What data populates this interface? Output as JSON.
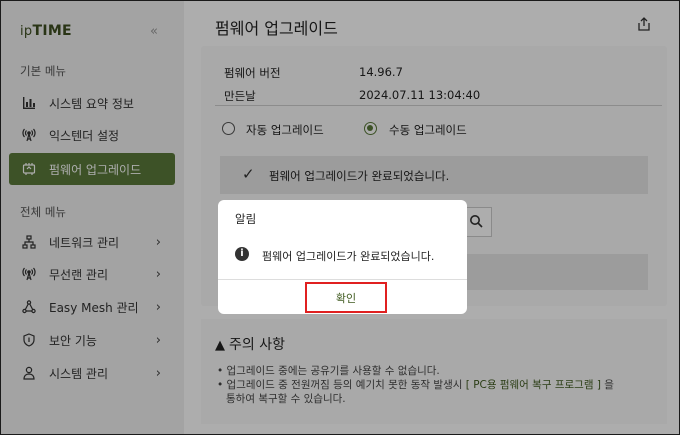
{
  "brand": {
    "prefix": "ip",
    "name": "TIME"
  },
  "sidebar": {
    "collapse_icon": "double-chevron-left-icon",
    "basic_section": "기본 메뉴",
    "basic_items": [
      {
        "label": "시스템 요약 정보",
        "icon": "bar-chart-icon"
      },
      {
        "label": "익스텐더 설정",
        "icon": "wireless-antenna-icon"
      },
      {
        "label": "펌웨어 업그레이드",
        "icon": "firmware-icon",
        "active": true
      }
    ],
    "all_section": "전체 메뉴",
    "all_items": [
      {
        "label": "네트워크 관리",
        "icon": "network-icon"
      },
      {
        "label": "무선랜 관리",
        "icon": "wireless-antenna-icon"
      },
      {
        "label": "Easy Mesh 관리",
        "icon": "mesh-icon"
      },
      {
        "label": "보안 기능",
        "icon": "shield-icon"
      },
      {
        "label": "시스템 관리",
        "icon": "person-icon"
      }
    ]
  },
  "main": {
    "title": "펌웨어 업그레이드",
    "version_label": "펌웨어 버전",
    "version_value": "14.96.7",
    "date_label": "만든날",
    "date_value": "2024.07.11 13:04:40",
    "auto_upgrade": "자동 업그레이드",
    "manual_upgrade": "수동 업그레이드",
    "selected_mode": "manual",
    "success_message": "펌웨어 업그레이드가 완료되었습니다.",
    "caution": {
      "title": "주의 사항",
      "line1": "• 업그레이드 중에는 공유기를 사용할 수 없습니다.",
      "line2_pre": "• 업그레이드 중 전원꺼짐 등의 예기치 못한 동작 발생시",
      "line2_link": "[ PC용 펌웨어 복구 프로그램 ]",
      "line2_post": "을",
      "line3": "통하여 복구할 수 있습니다."
    }
  },
  "dialog": {
    "title": "알림",
    "message": "펌웨어 업그레이드가 완료되었습니다.",
    "confirm": "확인"
  },
  "colors": {
    "accent": "#5a7a3a",
    "highlight_border": "#e02020"
  }
}
